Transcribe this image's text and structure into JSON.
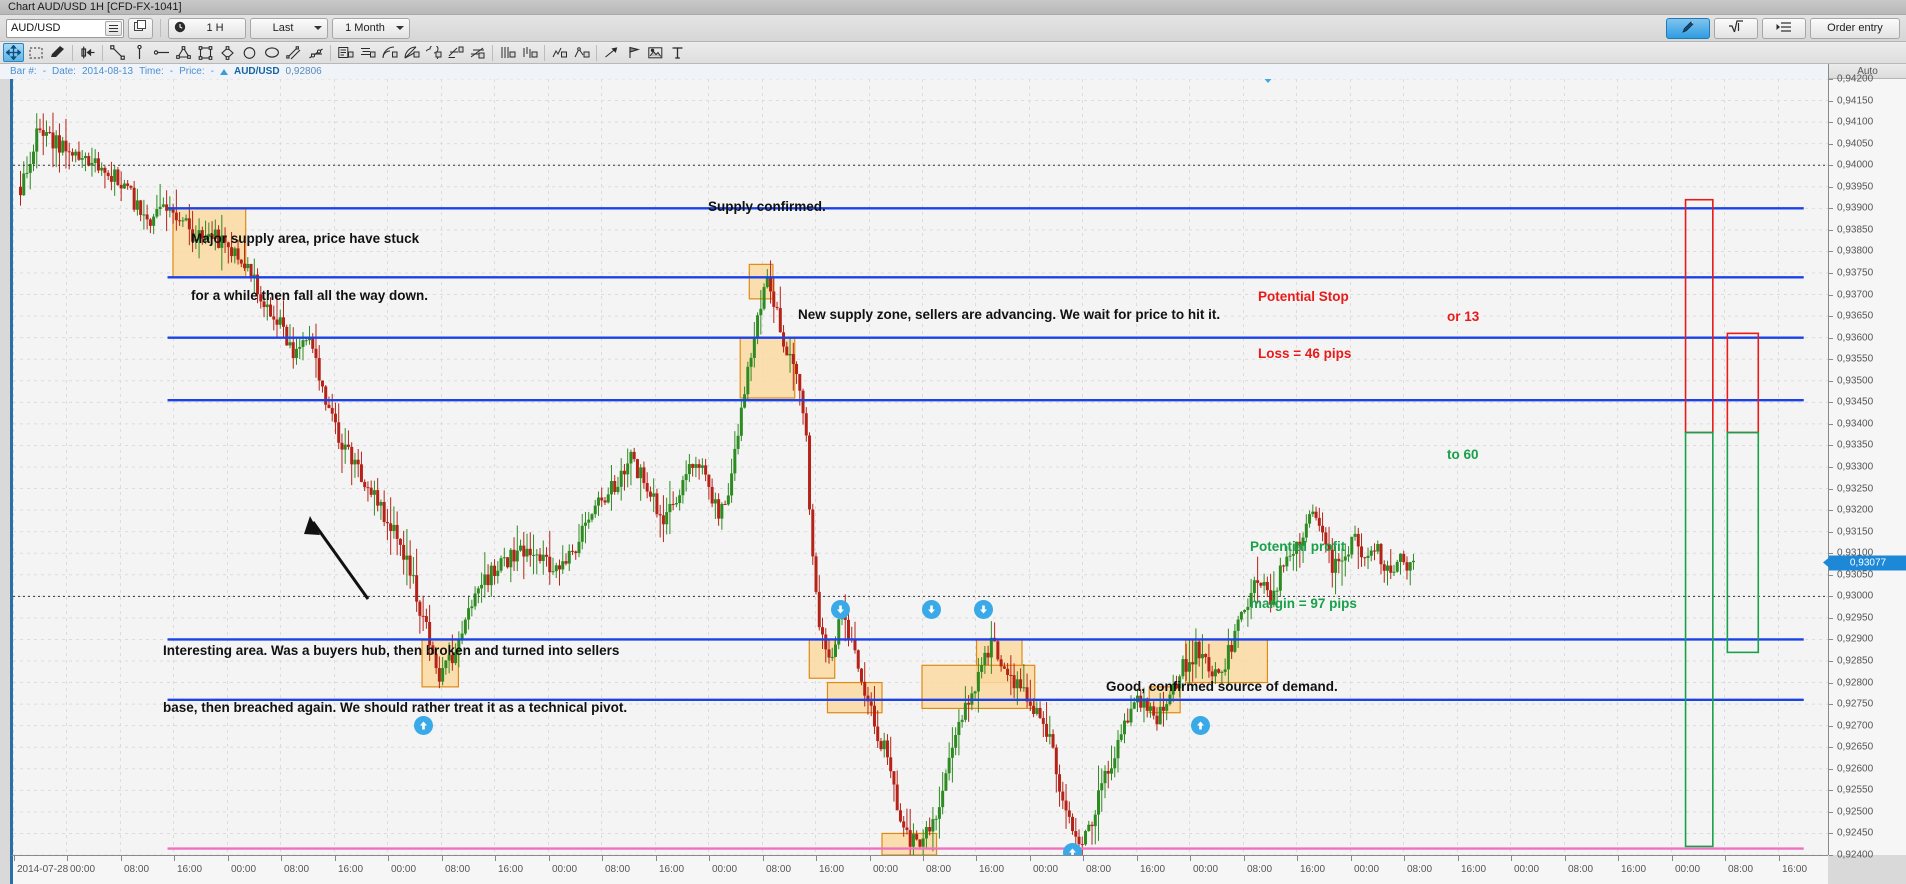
{
  "window": {
    "title": "Chart AUD/USD 1H [CFD-FX-1041]"
  },
  "toolbar": {
    "symbol_value": "AUD/USD",
    "symbol_list_icon": "list-icon",
    "duplicate_icon": "duplicate-icon",
    "clock_icon": "clock-icon",
    "timeframe": "1 H",
    "price_type": "Last",
    "range": "1 Month",
    "draw_icon": "pencil-icon",
    "indicator_icon": "indicator-icon",
    "properties_icon": "properties-icon",
    "order_entry_label": "Order entry"
  },
  "drawing_tools": [
    {
      "name": "crosshair-move-tool",
      "selected": true
    },
    {
      "name": "rectangle-select-tool",
      "selected": false
    },
    {
      "name": "eraser-tool",
      "selected": false
    },
    {
      "name": "bar-measure-tool",
      "selected": false
    },
    {
      "name": "trendline-tool",
      "selected": false
    },
    {
      "name": "vertical-line-tool",
      "selected": false
    },
    {
      "name": "horizontal-line-tool",
      "selected": false
    },
    {
      "name": "triangle-tool",
      "selected": false
    },
    {
      "name": "rectangle-tool",
      "selected": false
    },
    {
      "name": "diamond-tool",
      "selected": false
    },
    {
      "name": "circle-tool",
      "selected": false
    },
    {
      "name": "ellipse-tool",
      "selected": false
    },
    {
      "name": "parallel-channel-tool",
      "selected": false
    },
    {
      "name": "pitchfork-tool",
      "selected": false
    },
    {
      "name": "text-note-tool",
      "selected": false
    },
    {
      "name": "label-tool",
      "selected": false
    },
    {
      "name": "fibonacci-arc-tool",
      "selected": false
    },
    {
      "name": "fibonacci-fan-tool",
      "selected": false
    },
    {
      "name": "fibonacci-spiral-tool",
      "selected": false
    },
    {
      "name": "fibonacci-retracement-tool",
      "selected": false
    },
    {
      "name": "fibonacci-extension-tool",
      "selected": false
    },
    {
      "name": "gann-box-tool",
      "selected": false
    },
    {
      "name": "gann-fan-tool",
      "selected": false
    },
    {
      "name": "elliott-wave-tool",
      "selected": false
    },
    {
      "name": "cycle-lines-tool",
      "selected": false
    },
    {
      "name": "arrow-marker-tool",
      "selected": false
    },
    {
      "name": "flag-marker-tool",
      "selected": false
    },
    {
      "name": "image-tool",
      "selected": false
    },
    {
      "name": "text-tool",
      "selected": false
    }
  ],
  "infobar": {
    "bar_label": "Bar #:",
    "bar_value": "-",
    "date_label": "Date:",
    "date_value": "2014-08-13",
    "time_label": "Time:",
    "time_value": "-",
    "price_label": "Price:",
    "price_value": "-",
    "trend_icon": "up-triangle-icon",
    "symbol": "AUD/USD",
    "last_price": "0,92806"
  },
  "price_axis": {
    "auto_label": "Auto",
    "current_price": "0,93077",
    "labels": [
      "0,94200",
      "0,94150",
      "0,94100",
      "0,94050",
      "0,94000",
      "0,93950",
      "0,93900",
      "0,93850",
      "0,93800",
      "0,93750",
      "0,93700",
      "0,93650",
      "0,93600",
      "0,93550",
      "0,93500",
      "0,93450",
      "0,93400",
      "0,93350",
      "0,93300",
      "0,93250",
      "0,93200",
      "0,93150",
      "0,93100",
      "0,93050",
      "0,93000",
      "0,92950",
      "0,92900",
      "0,92850",
      "0,92800",
      "0,92750",
      "0,92700",
      "0,92650",
      "0,92600",
      "0,92550",
      "0,92500",
      "0,92450",
      "0,92400"
    ]
  },
  "time_axis": {
    "labels": [
      "2014-07-28",
      "00:00",
      "08:00",
      "16:00",
      "00:00",
      "08:00",
      "16:00",
      "00:00",
      "08:00",
      "16:00",
      "00:00",
      "08:00",
      "16:00",
      "00:00",
      "08:00",
      "16:00",
      "00:00",
      "08:00",
      "16:00",
      "00:00",
      "08:00",
      "16:00",
      "00:00",
      "08:00",
      "16:00",
      "00:00",
      "08:00",
      "16:00",
      "00:00",
      "08:00",
      "16:00",
      "00:00",
      "08:00",
      "16:00"
    ]
  },
  "annotations": {
    "supply_major_line1": "Major supply area, price have stuck",
    "supply_major_line2": "for a while then fall all the way down.",
    "supply_confirmed": "Supply confirmed.",
    "new_supply_zone": "New supply zone, sellers are advancing. We wait for price to hit it.",
    "stop_loss_line1": "Potential Stop",
    "stop_loss_line2": "Loss = 46 pips",
    "or_13": "or 13",
    "to_60": "to 60",
    "profit_line1": "Potential profit",
    "profit_line2": "margin = 97 pips",
    "pivot_line1": "Interesting area. Was a buyers hub, then broken and turned into sellers",
    "pivot_line2": "base, then breached again. We should rather treat it as a technical pivot.",
    "demand_confirmed": "Good, confirmed source of demand."
  },
  "colors": {
    "bull_candle": "#2e8b22",
    "bear_candle": "#b52318",
    "zone_fill": "#fad9a0",
    "zone_border": "#e08a16",
    "support_line": "#1b42e8",
    "stop_box": "#e81a1a",
    "profit_box": "#18a04a",
    "demand_line": "#f070c0",
    "signal_badge": "#39a9e8",
    "accent": "#2b6fa8"
  },
  "chart_data": {
    "type": "candlestick",
    "title": "Chart AUD/USD 1H [CFD-FX-1041]",
    "symbol": "AUD/USD",
    "timeframe": "1 H",
    "xlabel": "",
    "ylabel": "",
    "ylim": [
      0.924,
      0.942
    ],
    "grid": true,
    "legend": "none",
    "last_price": 0.93077,
    "price_tick": 0.0005,
    "supply_zones": [
      {
        "label": "Major supply area",
        "y_top": 0.939,
        "y_bottom": 0.9374,
        "x_start": 0.088,
        "x_end": 0.128
      },
      {
        "label": "Supply confirmed",
        "y_top": 0.9377,
        "y_bottom": 0.9369,
        "x_start": 0.405,
        "x_end": 0.418
      },
      {
        "label": "New supply zone",
        "y_top": 0.936,
        "y_bottom": 0.9346,
        "x_start": 0.4,
        "x_end": 0.43
      }
    ],
    "demand_zones": [
      {
        "y_top": 0.929,
        "y_bottom": 0.9279,
        "x_start": 0.225,
        "x_end": 0.245
      },
      {
        "y_top": 0.929,
        "y_bottom": 0.9281,
        "x_start": 0.438,
        "x_end": 0.452
      },
      {
        "y_top": 0.928,
        "y_bottom": 0.9273,
        "x_start": 0.448,
        "x_end": 0.478
      },
      {
        "y_top": 0.9284,
        "y_bottom": 0.9274,
        "x_start": 0.5,
        "x_end": 0.562
      },
      {
        "y_top": 0.929,
        "y_bottom": 0.928,
        "x_start": 0.53,
        "x_end": 0.555
      },
      {
        "y_top": 0.9279,
        "y_bottom": 0.9273,
        "x_start": 0.625,
        "x_end": 0.642
      },
      {
        "y_top": 0.929,
        "y_bottom": 0.928,
        "x_start": 0.645,
        "x_end": 0.69
      },
      {
        "y_top": 0.9245,
        "y_bottom": 0.924,
        "x_start": 0.478,
        "x_end": 0.508
      }
    ],
    "horizontal_lines": [
      {
        "price": 0.939,
        "color": "#1b42e8"
      },
      {
        "price": 0.9374,
        "color": "#1b42e8"
      },
      {
        "price": 0.936,
        "color": "#1b42e8"
      },
      {
        "price": 0.93455,
        "color": "#1b42e8"
      },
      {
        "price": 0.929,
        "color": "#1b42e8"
      },
      {
        "price": 0.9276,
        "color": "#1b42e8"
      },
      {
        "price": 0.92415,
        "color": "#f070c0"
      },
      {
        "price": 0.94,
        "color": "#333333",
        "style": "dotted"
      },
      {
        "price": 0.93,
        "color": "#333333",
        "style": "dotted"
      }
    ],
    "risk_boxes": [
      {
        "name": "stop-loss-box-1",
        "color": "#e81a1a",
        "y_top": 0.9392,
        "y_bottom": 0.9338,
        "x_start": 0.92,
        "x_end": 0.935
      },
      {
        "name": "stop-loss-box-2",
        "color": "#e81a1a",
        "y_top": 0.9361,
        "y_bottom": 0.9338,
        "x_start": 0.943,
        "x_end": 0.96
      },
      {
        "name": "profit-box-1",
        "color": "#18a04a",
        "y_top": 0.9338,
        "y_bottom": 0.9242,
        "x_start": 0.92,
        "x_end": 0.935
      },
      {
        "name": "profit-box-2",
        "color": "#18a04a",
        "y_top": 0.9338,
        "y_bottom": 0.9287,
        "x_start": 0.943,
        "x_end": 0.96
      }
    ],
    "signals": [
      {
        "type": "buy",
        "x": 0.226,
        "price": 0.927
      },
      {
        "type": "sell",
        "x": 0.455,
        "price": 0.9297
      },
      {
        "type": "sell",
        "x": 0.505,
        "price": 0.9297
      },
      {
        "type": "sell",
        "x": 0.534,
        "price": 0.9297
      },
      {
        "type": "buy",
        "x": 0.583,
        "price": 0.92405
      },
      {
        "type": "buy",
        "x": 0.653,
        "price": 0.927
      }
    ],
    "stop_loss_pips": 46,
    "profit_pips": 97,
    "reward_low": 13,
    "reward_high": 60
  }
}
